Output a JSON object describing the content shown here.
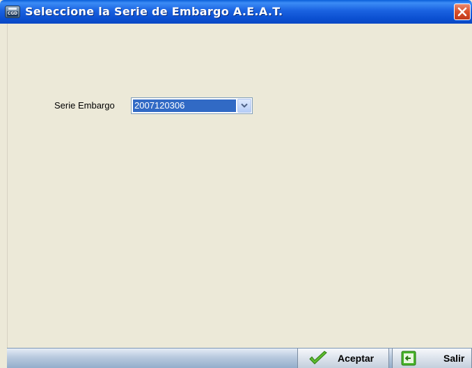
{
  "window": {
    "title": "Seleccione la Serie de Embargo A.E.A.T.",
    "icon": "cgd-app-icon",
    "close_icon": "close-icon",
    "title_icon_text": "CGD"
  },
  "form": {
    "serie_label": "Serie Embargo",
    "serie_value": "2007120306",
    "dropdown_icon": "chevron-down-icon"
  },
  "footer": {
    "accept_label": "Aceptar",
    "accept_icon": "checkmark-icon",
    "exit_label": "Salir",
    "exit_icon": "exit-arrow-icon"
  },
  "colors": {
    "titlebar": "#0A4FD0",
    "selection": "#316AC5",
    "close": "#D9502A",
    "background": "#ECE9D8"
  }
}
